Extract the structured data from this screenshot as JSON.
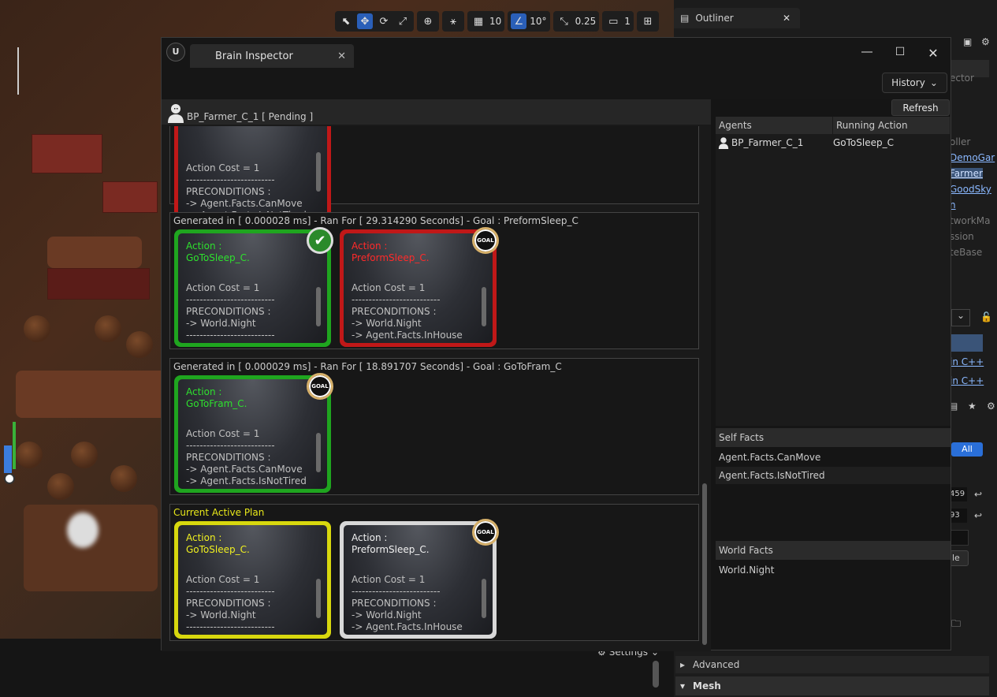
{
  "viewport_toolbar": {
    "grid_size": "10",
    "rotation_snap": "10°",
    "scale_snap": "0.25",
    "camera_speed": "1"
  },
  "outliner": {
    "tab_label": "Outliner"
  },
  "side_panel": {
    "gray_top": "ector",
    "labels": [
      "oller",
      "DemoGar",
      "Farmer",
      "GoodSky",
      "n",
      "tworkMa",
      "ssion",
      "teBase"
    ],
    "in_cpp_1": "in C++",
    "in_cpp_2": "in C++",
    "all_button": "All",
    "num1": "459",
    "num2": "93",
    "le": "le",
    "advanced": "Advanced",
    "mesh": "Mesh",
    "settings": "Settings"
  },
  "brain_inspector": {
    "tab_title": "Brain Inspector",
    "history_label": "History",
    "refresh_label": "Refresh",
    "agent_header": "BP_Farmer_C_1 [ Pending ]",
    "plans": [
      {
        "title": "",
        "cards": [
          {
            "color": "red",
            "line1": "Action Cost = 1",
            "line2": "--------------------------",
            "line3": "PRECONDITIONS :",
            "line4": "-> Agent.Facts.CanMove",
            "line5": "-> Agent.Facts.IsNotTired"
          }
        ]
      },
      {
        "title": "Generated in [ 0.000028 ms] - Ran For [ 29.314290 Seconds] - Goal : PreformSleep_C",
        "cards": [
          {
            "color": "green",
            "action_label": "Action :",
            "action_name": "GoToSleep_C.",
            "cost": "Action Cost = 1",
            "sep": "--------------------------",
            "pre": "PRECONDITIONS :",
            "p1": "-> World.Night",
            "p2": "--------------------------",
            "badge": "check"
          },
          {
            "color": "red",
            "action_label": "Action :",
            "action_name": "PreformSleep_C.",
            "cost": "Action Cost = 1",
            "sep": "--------------------------",
            "pre": "PRECONDITIONS :",
            "p1": "-> World.Night",
            "p2": "-> Agent.Facts.InHouse",
            "badge": "GOAL"
          }
        ]
      },
      {
        "title": "Generated in [ 0.000029 ms] - Ran For [ 18.891707 Seconds] - Goal : GoToFram_C",
        "cards": [
          {
            "color": "green",
            "action_label": "Action :",
            "action_name": "GoToFram_C.",
            "cost": "Action Cost = 1",
            "sep": "--------------------------",
            "pre": "PRECONDITIONS :",
            "p1": "-> Agent.Facts.CanMove",
            "p2": "-> Agent.Facts.IsNotTired",
            "badge": "GOAL"
          }
        ]
      },
      {
        "title": "Current Active Plan",
        "cards": [
          {
            "color": "yellow",
            "action_label": "Action :",
            "action_name": "GoToSleep_C.",
            "cost": "Action Cost = 1",
            "sep": "--------------------------",
            "pre": "PRECONDITIONS :",
            "p1": "-> World.Night",
            "p2": "--------------------------"
          },
          {
            "color": "gray",
            "action_label": "Action :",
            "action_name": "PreformSleep_C.",
            "cost": "Action Cost = 1",
            "sep": "--------------------------",
            "pre": "PRECONDITIONS :",
            "p1": "-> World.Night",
            "p2": "-> Agent.Facts.InHouse",
            "badge": "GOAL"
          }
        ]
      }
    ],
    "agents_table": {
      "headers": [
        "Agents",
        "Running Action"
      ],
      "rows": [
        {
          "agent": "BP_Farmer_C_1",
          "action": "GoToSleep_C"
        }
      ]
    },
    "self_facts": {
      "header": "Self Facts",
      "items": [
        "Agent.Facts.CanMove",
        "Agent.Facts.IsNotTired"
      ]
    },
    "world_facts": {
      "header": "World Facts",
      "items": [
        "World.Night"
      ]
    }
  },
  "colors": {
    "red": "#c01818",
    "green": "#1fa51f",
    "yellow": "#d8d80e",
    "gray": "#d8d8d8",
    "accent": "#2a5fb8"
  }
}
